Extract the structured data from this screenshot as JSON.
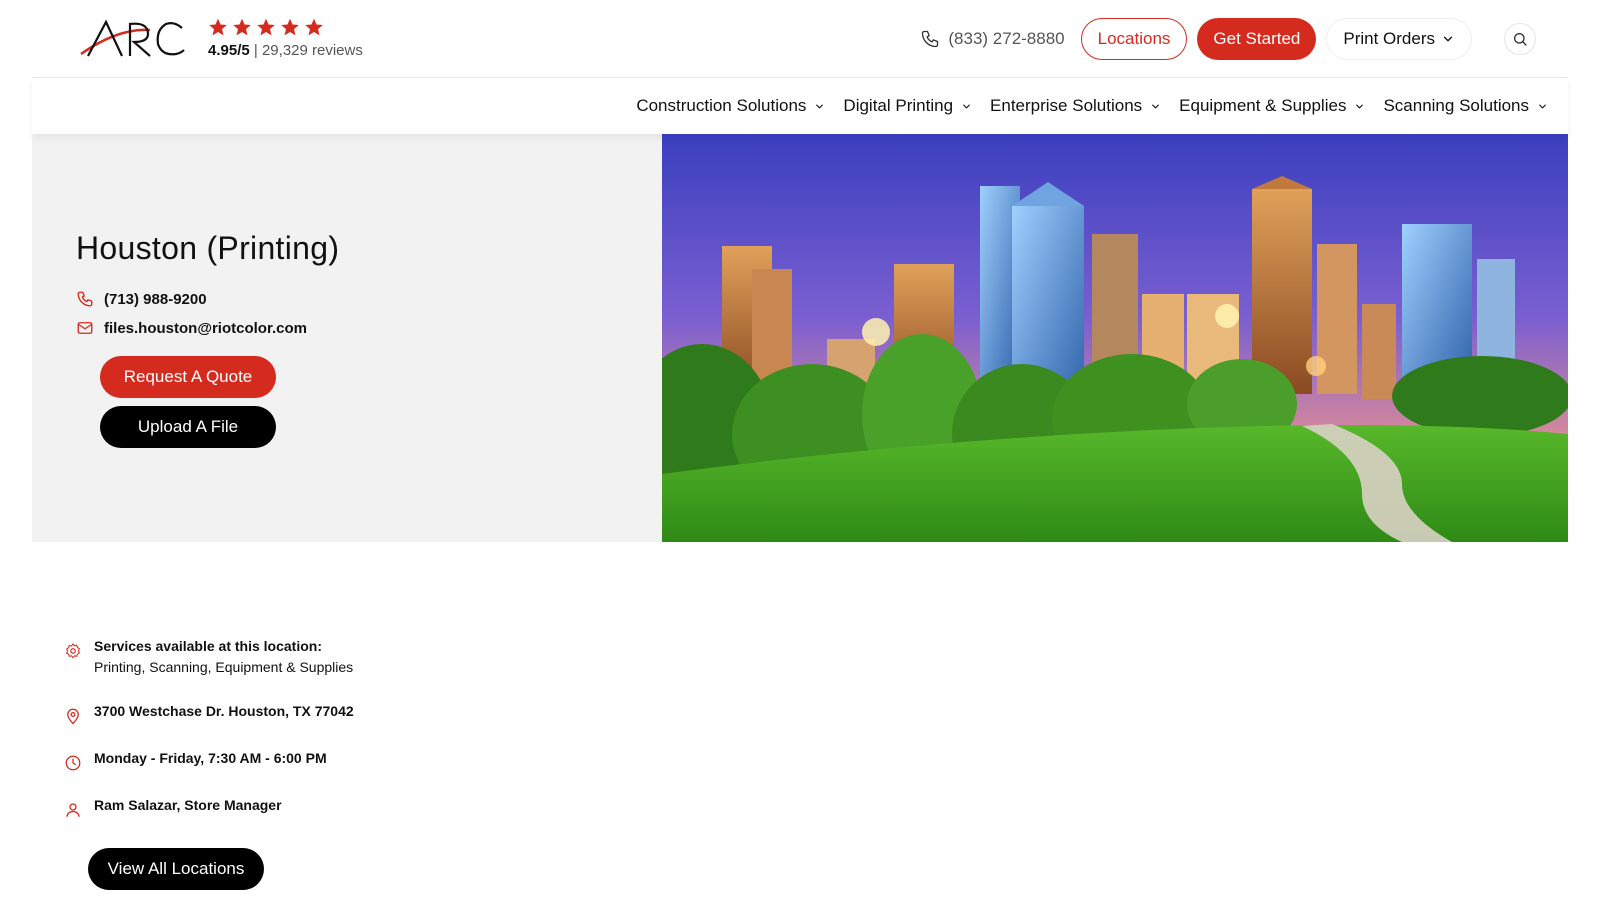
{
  "header": {
    "logo_text": "ARC",
    "rating_value": "4.95/5",
    "rating_separator": "|",
    "rating_reviews": "29,329 reviews",
    "phone": "(833) 272-8880",
    "locations_label": "Locations",
    "get_started_label": "Get Started",
    "print_orders_label": "Print Orders"
  },
  "nav": {
    "items": [
      {
        "label": "Construction Solutions"
      },
      {
        "label": "Digital Printing"
      },
      {
        "label": "Enterprise Solutions"
      },
      {
        "label": "Equipment & Supplies"
      },
      {
        "label": "Scanning Solutions"
      }
    ]
  },
  "hero": {
    "title": "Houston (Printing)",
    "phone": "(713) 988-9200",
    "email": "files.houston@riotcolor.com",
    "request_quote_label": "Request A Quote",
    "upload_file_label": "Upload A File"
  },
  "details": {
    "services_heading": "Services available at this location:",
    "services_list": "Printing, Scanning, Equipment & Supplies",
    "address": "3700 Westchase Dr. Houston, TX 77042",
    "hours": "Monday - Friday, 7:30 AM - 6:00 PM",
    "manager": "Ram Salazar, Store Manager",
    "view_all_label": "View All Locations"
  },
  "colors": {
    "accent": "#d52b1e",
    "dark": "#000000",
    "panel": "#f2f2f2"
  },
  "icons": [
    "star-icon",
    "phone-icon",
    "chevron-down-icon",
    "search-icon",
    "mail-icon",
    "gear-icon",
    "map-pin-icon",
    "clock-icon",
    "user-icon"
  ]
}
